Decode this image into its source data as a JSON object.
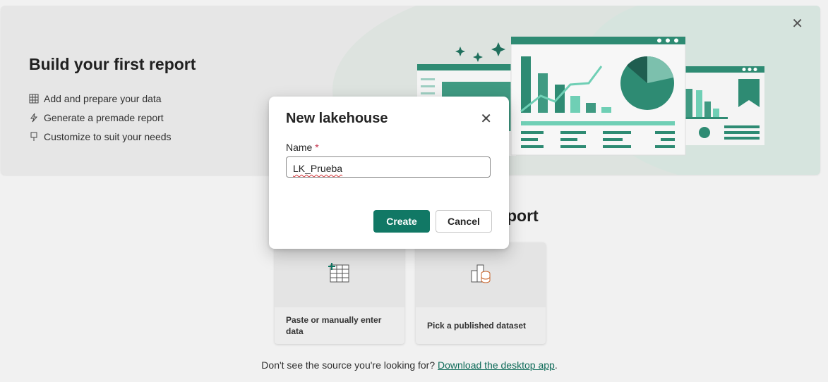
{
  "banner": {
    "title": "Build your first report",
    "features": [
      {
        "icon": "table-icon",
        "label": "Add and prepare your data"
      },
      {
        "icon": "lightning-icon",
        "label": "Generate a premade report"
      },
      {
        "icon": "paintbrush-icon",
        "label": "Customize to suit your needs"
      }
    ],
    "close_icon": "close-icon"
  },
  "section": {
    "title_visible_fragment": "port"
  },
  "cards": [
    {
      "icon": "table-edit-icon",
      "label": "Paste or manually enter data"
    },
    {
      "icon": "dataset-icon",
      "label": "Pick a published dataset"
    }
  ],
  "footer": {
    "text": "Don't see the source you're looking for?",
    "link": "Download the desktop app",
    "suffix": "."
  },
  "dialog": {
    "title": "New lakehouse",
    "name_label": "Name",
    "required_marker": "*",
    "name_value": "LK_Prueba",
    "create_label": "Create",
    "cancel_label": "Cancel"
  },
  "colors": {
    "accent": "#117865",
    "illustration_teal": "#2e8b73",
    "illustration_mint": "#6fcfb5"
  }
}
